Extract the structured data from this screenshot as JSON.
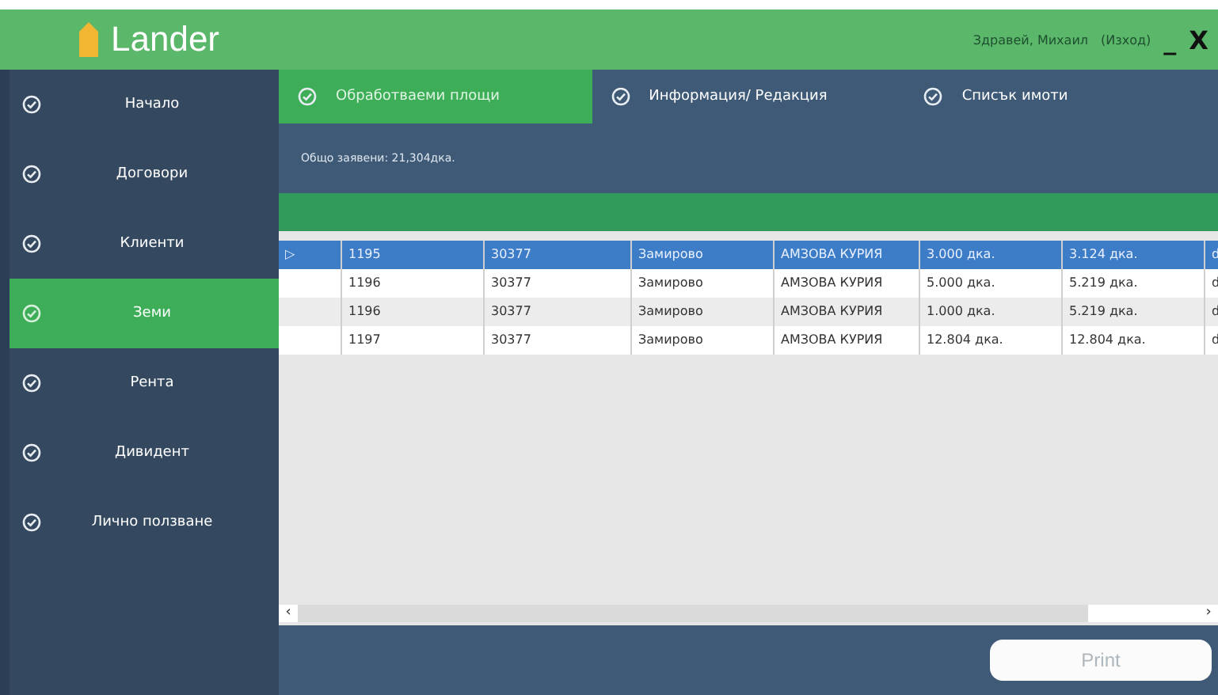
{
  "header": {
    "logo": "Lander",
    "user": "Здравей, Михаил",
    "logout": "(Изход)",
    "minimize": "_",
    "close": "X"
  },
  "sidebar": {
    "items": [
      {
        "label": "Начало",
        "selected": false
      },
      {
        "label": "Договори",
        "selected": false
      },
      {
        "label": "Клиенти",
        "selected": false
      },
      {
        "label": "Земи",
        "selected": true
      },
      {
        "label": "Рента",
        "selected": false
      },
      {
        "label": "Дивидент",
        "selected": false
      },
      {
        "label": "Лично ползване",
        "selected": false
      }
    ]
  },
  "tabs": [
    {
      "label": "Обработваеми площи",
      "selected": true
    },
    {
      "label": "Информация/ Редакция",
      "selected": false
    },
    {
      "label": "Списък имоти",
      "selected": false
    }
  ],
  "summary": "Общо заявени: 21,304дка.",
  "table": {
    "rows": [
      {
        "marker": "▷",
        "selected": true,
        "cells": [
          "1195",
          "30377",
          "Замирово",
          "АМЗОВА КУРИЯ",
          "3.000 дка.",
          "3.124 дка.",
          "d"
        ]
      },
      {
        "selected": false,
        "cells": [
          "1196",
          "30377",
          "Замирово",
          "АМЗОВА КУРИЯ",
          "5.000 дка.",
          "5.219 дка.",
          "d"
        ]
      },
      {
        "selected": false,
        "cells": [
          "1196",
          "30377",
          "Замирово",
          "АМЗОВА КУРИЯ",
          "1.000 дка.",
          "5.219 дка.",
          "d"
        ]
      },
      {
        "selected": false,
        "cells": [
          "1197",
          "30377",
          "Замирово",
          "АМЗОВА КУРИЯ",
          "12.804 дка.",
          "12.804 дка.",
          "d"
        ]
      }
    ],
    "scroll_left": "‹",
    "scroll_right": "›"
  },
  "print_button": {
    "label": "Print",
    "disabled": true
  }
}
